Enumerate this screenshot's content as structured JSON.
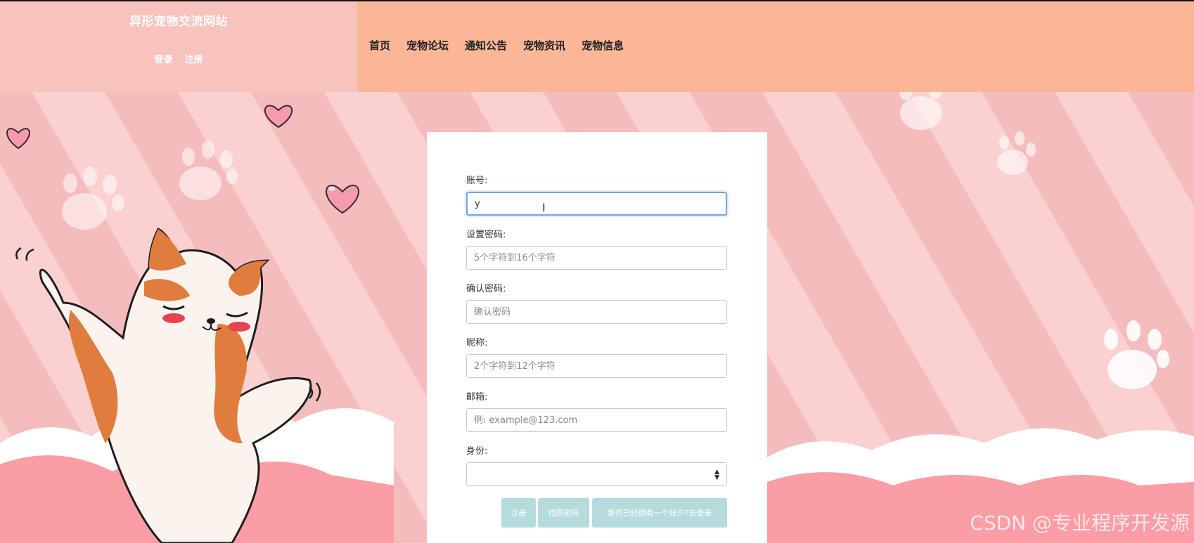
{
  "header": {
    "site_title": "异形宠物交流网站",
    "login": "登录",
    "register": "注册",
    "nav": [
      "首页",
      "宠物论坛",
      "通知公告",
      "宠物资讯",
      "宠物信息"
    ]
  },
  "form": {
    "account": {
      "label": "账号:",
      "value": "y"
    },
    "password": {
      "label": "设置密码:",
      "placeholder": "5个字符到16个字符"
    },
    "confirm": {
      "label": "确认密码:",
      "placeholder": "确认密码"
    },
    "nickname": {
      "label": "昵称:",
      "placeholder": "2个字符到12个字符"
    },
    "email": {
      "label": "邮箱:",
      "placeholder": "例: example@123.com"
    },
    "role": {
      "label": "身份:",
      "value": ""
    },
    "buttons": {
      "register": "注册",
      "recover": "找回密码",
      "goto_login": "是否已经拥有一个账户?去登录"
    }
  },
  "watermark": "CSDN @专业程序开发源",
  "colors": {
    "brand_panel": "#f8c3bd",
    "nav_panel": "#fbb698",
    "button": "#b5dbdd",
    "focus": "#7aa7df"
  },
  "icons": [
    "heart-icon",
    "paw-icon",
    "cat-illustration",
    "select-arrow-icon",
    "text-cursor-icon"
  ]
}
